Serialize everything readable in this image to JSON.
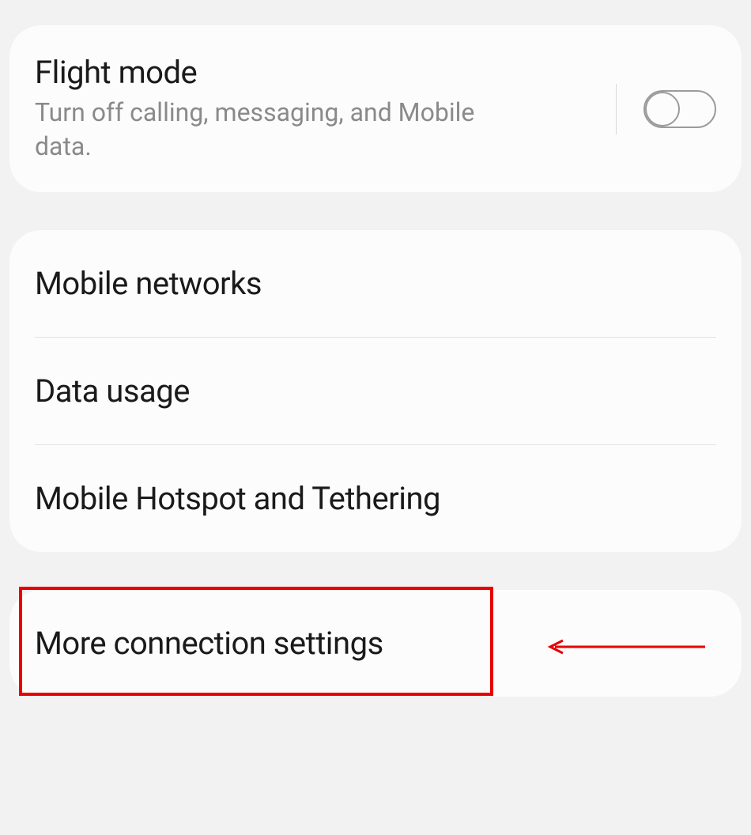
{
  "flightMode": {
    "title": "Flight mode",
    "subtitle": "Turn off calling, messaging, and Mobile data.",
    "enabled": false
  },
  "networks": {
    "mobileNetworks": "Mobile networks",
    "dataUsage": "Data usage",
    "hotspot": "Mobile Hotspot and Tethering"
  },
  "moreConnections": {
    "title": "More connection settings"
  }
}
